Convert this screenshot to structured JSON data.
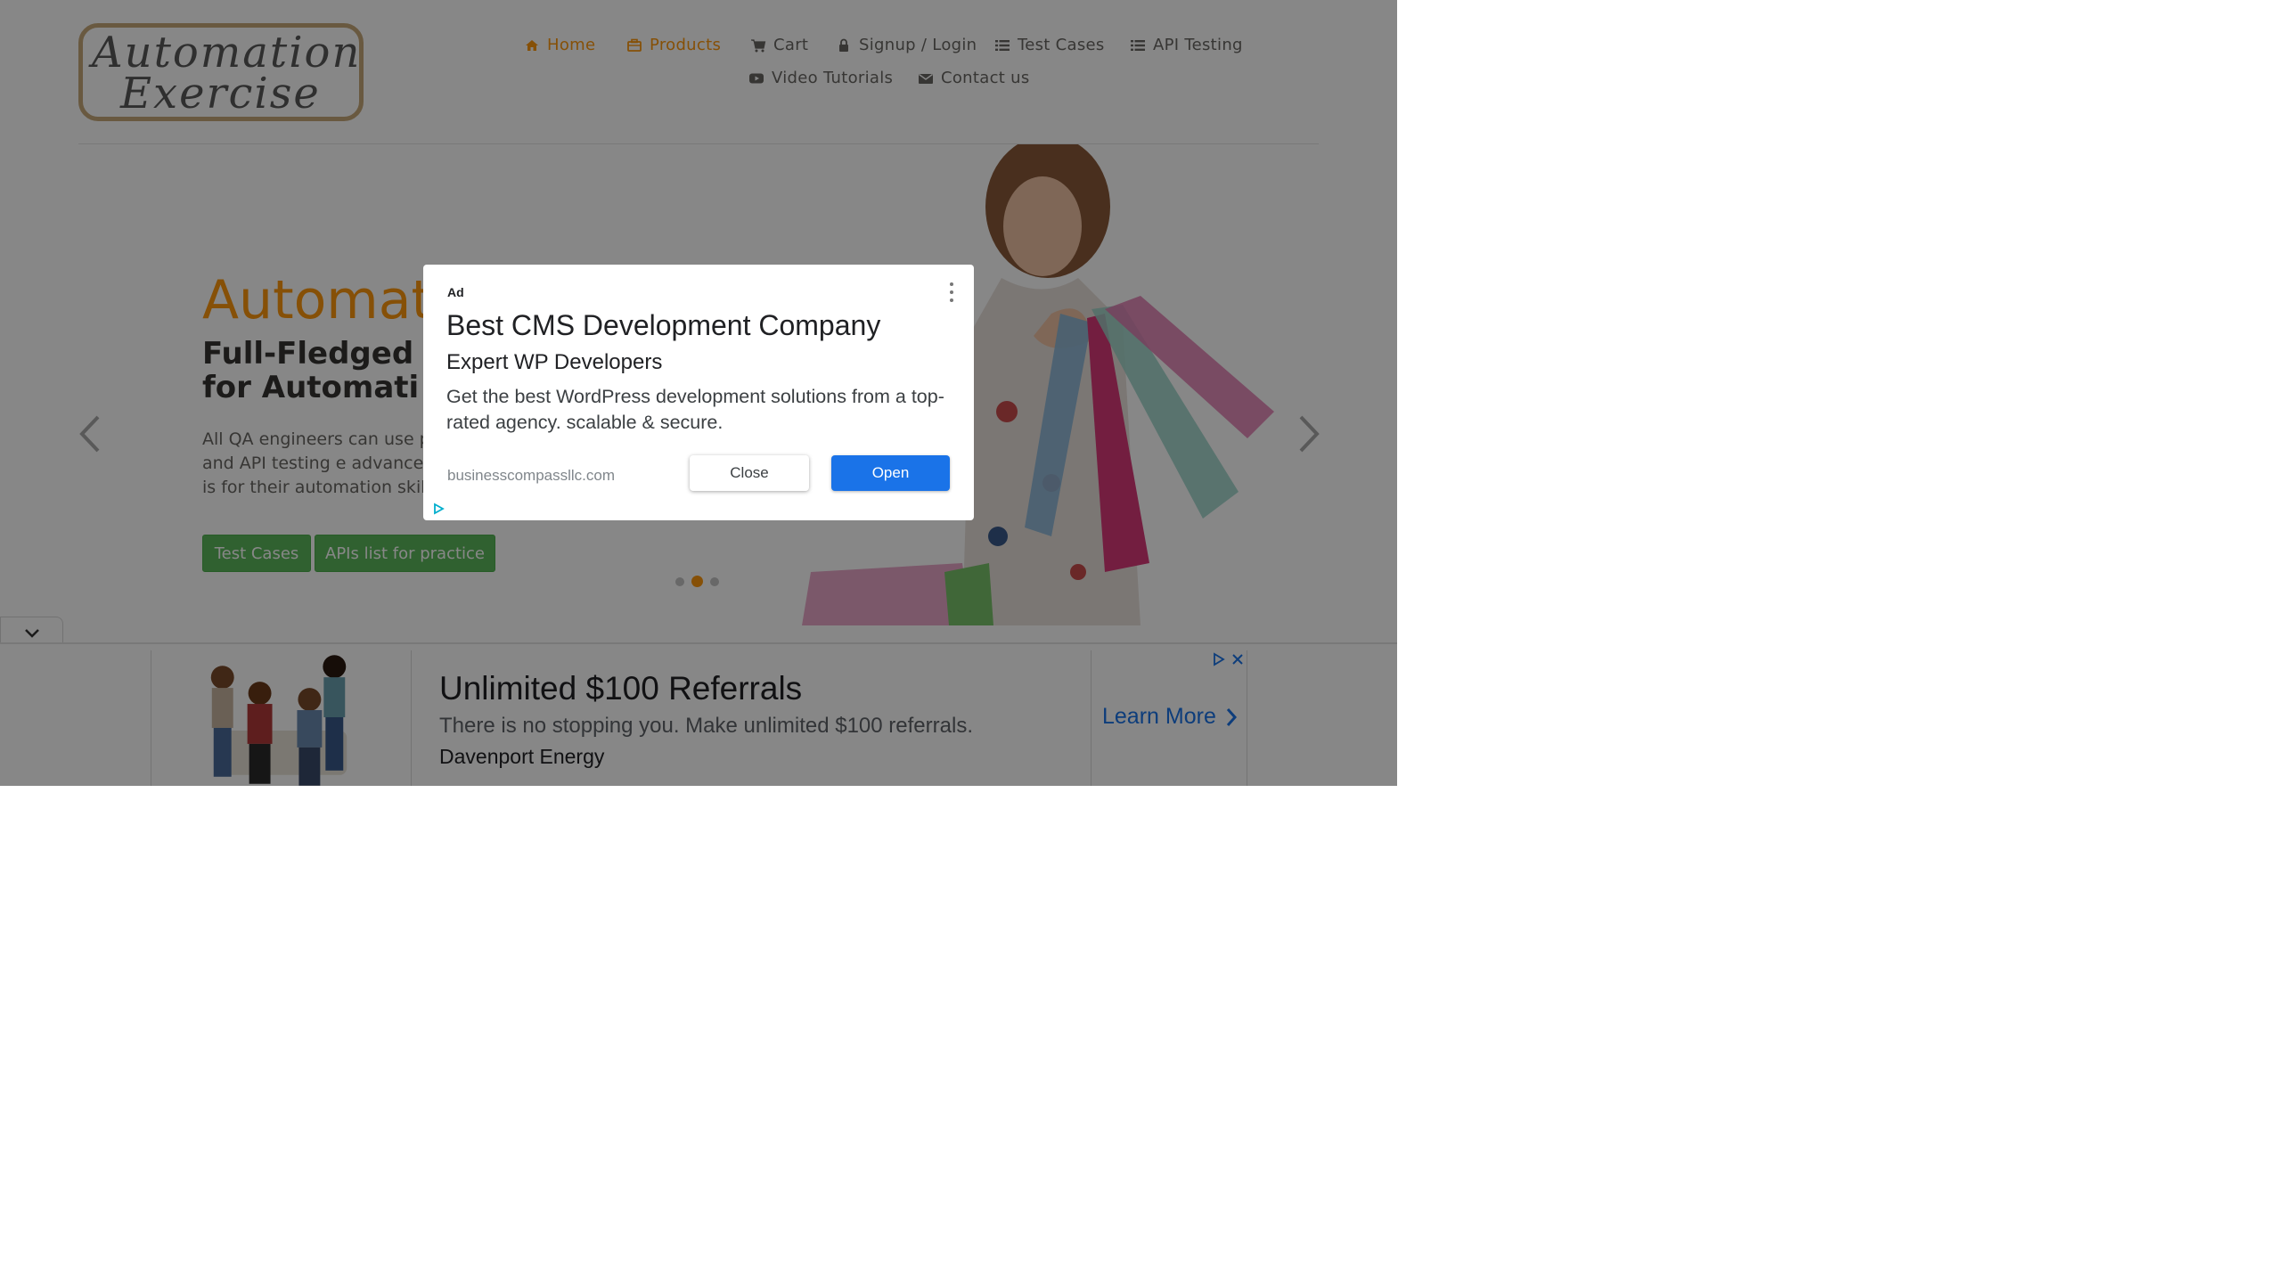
{
  "colors": {
    "brand_orange": "#fe980f",
    "text_gray": "#696763",
    "button_green": "#5cb85c",
    "ad_blue": "#1a73e8",
    "overlay": "rgba(0,0,0,0.47)"
  },
  "logo": {
    "line1": "Automation",
    "line2": "Exercise"
  },
  "nav": {
    "items": [
      {
        "label": "Home",
        "icon": "home-icon"
      },
      {
        "label": "Products",
        "icon": "briefcase-icon"
      },
      {
        "label": "Cart",
        "icon": "cart-icon"
      },
      {
        "label": "Signup / Login",
        "icon": "lock-icon"
      },
      {
        "label": "Test Cases",
        "icon": "list-icon"
      },
      {
        "label": "API Testing",
        "icon": "list-icon"
      },
      {
        "label": "Video Tutorials",
        "icon": "youtube-play-icon"
      },
      {
        "label": "Contact us",
        "icon": "envelope-icon"
      }
    ]
  },
  "hero": {
    "title": "Automat",
    "subtitle_line1": "Full-Fledged",
    "subtitle_line2": "for Automati",
    "text": "All QA engineers can use practice and API testing e advance level. This is for their automation skills.",
    "buttons": {
      "test_cases": "Test Cases",
      "apis": "APIs list for practice"
    },
    "slide_indicator": {
      "count": 3,
      "active_index": 1
    }
  },
  "modal_ad": {
    "ad_label": "Ad",
    "title": "Best CMS Development Company",
    "subtitle": "Expert WP Developers",
    "description": "Get the best WordPress development solutions from a top-rated agency. scalable & secure.",
    "url": "businesscompassllc.com",
    "close_label": "Close",
    "open_label": "Open"
  },
  "banner_ad": {
    "title": "Unlimited $100 Referrals",
    "description": "There is no stopping you. Make unlimited $100 referrals.",
    "advertiser": "Davenport Energy",
    "cta": "Learn More"
  }
}
